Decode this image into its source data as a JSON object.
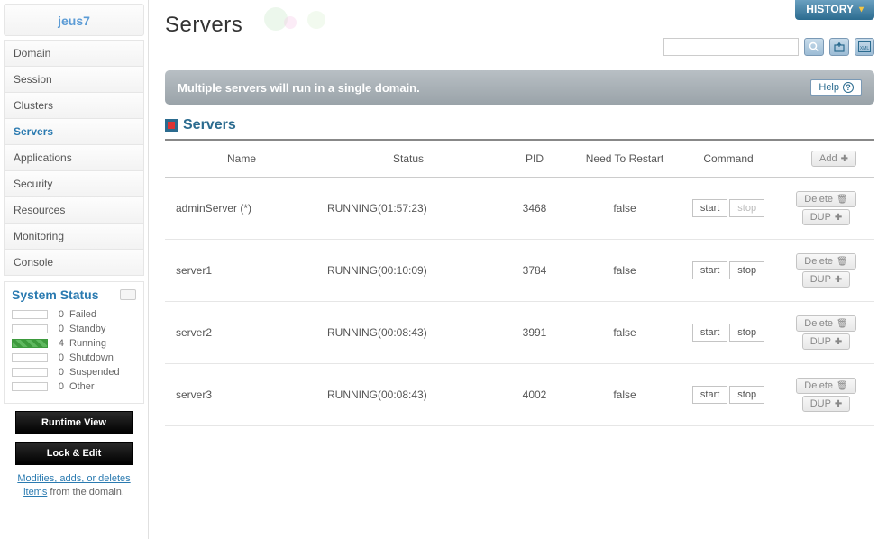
{
  "brand": "jeus7",
  "nav": {
    "items": [
      "Domain",
      "Session",
      "Clusters",
      "Servers",
      "Applications",
      "Security",
      "Resources",
      "Monitoring",
      "Console"
    ],
    "active_index": 3
  },
  "status": {
    "title": "System Status",
    "rows": [
      {
        "count": 0,
        "label": "Failed",
        "running": false
      },
      {
        "count": 0,
        "label": "Standby",
        "running": false
      },
      {
        "count": 4,
        "label": "Running",
        "running": true
      },
      {
        "count": 0,
        "label": "Shutdown",
        "running": false
      },
      {
        "count": 0,
        "label": "Suspended",
        "running": false
      },
      {
        "count": 0,
        "label": "Other",
        "running": false
      }
    ]
  },
  "sidebar_buttons": {
    "runtime": "Runtime View",
    "lock": "Lock & Edit"
  },
  "sidebar_note": {
    "link": "Modifies, adds, or deletes items",
    "rest": " from the domain."
  },
  "history_label": "HISTORY",
  "page_title": "Servers",
  "search_placeholder": "",
  "banner": {
    "text": "Multiple servers will run in a single domain.",
    "help": "Help"
  },
  "section_title": "Servers",
  "table": {
    "columns": [
      "Name",
      "Status",
      "PID",
      "Need To Restart",
      "Command",
      ""
    ],
    "add_label": "Add",
    "start_label": "start",
    "stop_label": "stop",
    "delete_label": "Delete",
    "dup_label": "DUP",
    "rows": [
      {
        "name": "adminServer (*)",
        "status": "RUNNING(01:57:23)",
        "pid": "3468",
        "restart": "false",
        "stop_disabled": true
      },
      {
        "name": "server1",
        "status": "RUNNING(00:10:09)",
        "pid": "3784",
        "restart": "false",
        "stop_disabled": false
      },
      {
        "name": "server2",
        "status": "RUNNING(00:08:43)",
        "pid": "3991",
        "restart": "false",
        "stop_disabled": false
      },
      {
        "name": "server3",
        "status": "RUNNING(00:08:43)",
        "pid": "4002",
        "restart": "false",
        "stop_disabled": false
      }
    ]
  }
}
